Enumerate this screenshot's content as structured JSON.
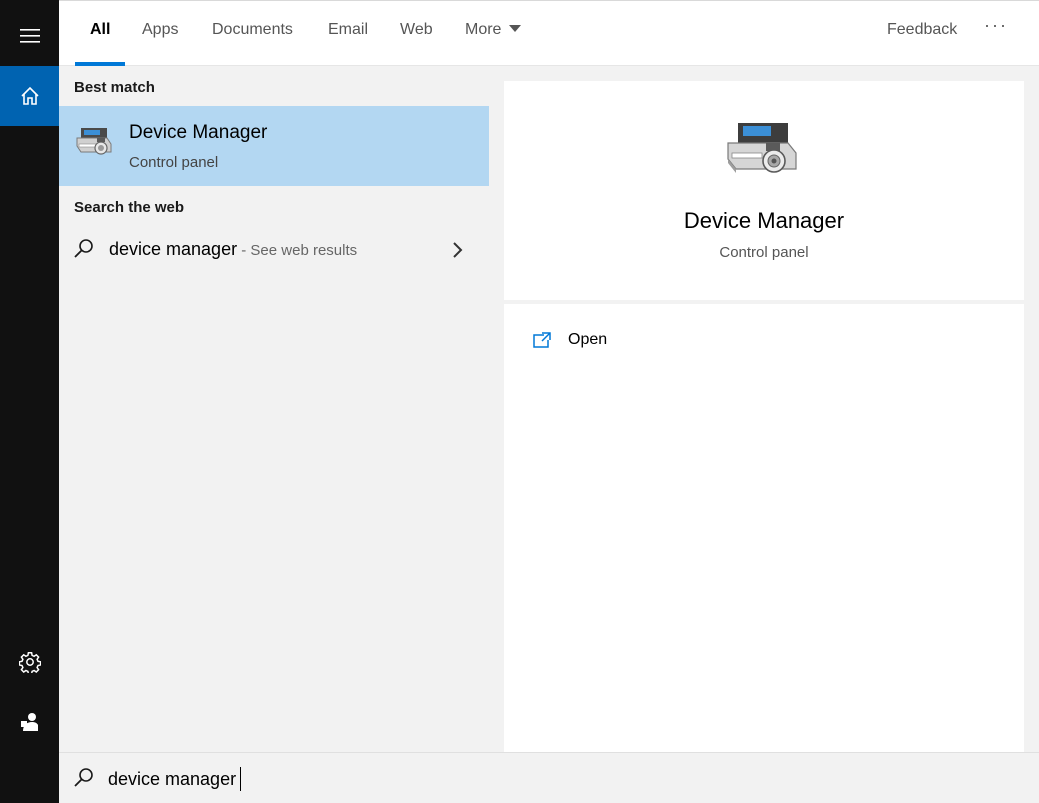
{
  "rail": {
    "items": [
      {
        "icon": "hamburger-menu-icon"
      },
      {
        "icon": "home-icon",
        "selected": true
      },
      {
        "icon": "settings-gear-icon"
      },
      {
        "icon": "account-icon"
      }
    ]
  },
  "tabs": [
    {
      "label": "All",
      "active": true
    },
    {
      "label": "Apps"
    },
    {
      "label": "Documents"
    },
    {
      "label": "Email"
    },
    {
      "label": "Web"
    },
    {
      "label": "More"
    }
  ],
  "header": {
    "feedback_label": "Feedback",
    "more_options_label": "···"
  },
  "results": {
    "best_match_header": "Best match",
    "best_match": {
      "title": "Device Manager",
      "subtitle": "Control panel",
      "icon": "device-manager-icon"
    },
    "web_header": "Search the web",
    "web_result": {
      "query": "device manager",
      "suffix": " - See web results"
    }
  },
  "preview": {
    "title": "Device Manager",
    "subtitle": "Control panel",
    "actions": [
      {
        "label": "Open",
        "icon": "open-external-icon"
      }
    ]
  },
  "search": {
    "value": "device manager"
  },
  "colors": {
    "accent": "#0078d7",
    "rail_bg": "#111111",
    "rail_selected": "#0063b1",
    "selected_item_bg": "#b3d7f2",
    "pane_bg": "#f2f2f2"
  }
}
